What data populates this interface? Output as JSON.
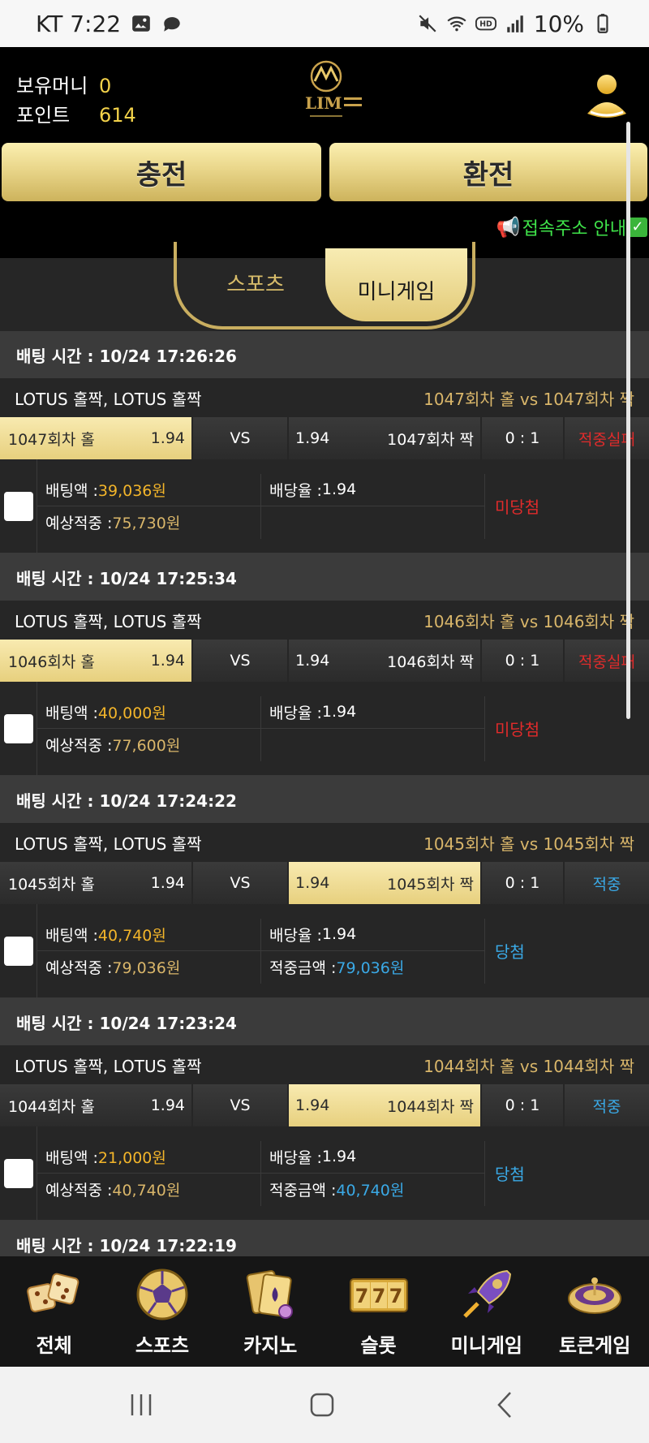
{
  "status_bar": {
    "carrier_time": "KT 7:22",
    "battery": "10%",
    "icons": [
      "image-icon",
      "chat-icon",
      "mute-icon",
      "wifi-icon",
      "hd-icon",
      "signal-icon",
      "battery-icon"
    ]
  },
  "header": {
    "balance_label": "보유머니",
    "balance_value": "0",
    "point_label": "포인트",
    "point_value": "614",
    "logo_text": "LIM",
    "charge_label": "충전",
    "exchange_label": "환전",
    "notice": "접속주소 안내"
  },
  "tabs": {
    "sports": "스포츠",
    "minigame": "미니게임"
  },
  "bets": [
    {
      "time": "배팅 시간 : 10/24 17:26:26",
      "game": "LOTUS 홀짝, LOTUS 홀짝",
      "match": "1047회차 홀  vs  1047회차 짝",
      "home": "1047회차 홀",
      "home_odds": "1.94",
      "vs": "VS",
      "away_odds": "1.94",
      "away": "1047회차 짝",
      "score": "0 : 1",
      "result": "적중실패",
      "selected": "home",
      "win": false,
      "bet_label": "배팅액 : ",
      "bet_amount": "39,036원",
      "odds_label": "배당율 : ",
      "odds": "1.94",
      "expected_label": "예상적중 : ",
      "expected": "75,730원",
      "payout_label": "",
      "payout": "",
      "status": "미당첨"
    },
    {
      "time": "배팅 시간 : 10/24 17:25:34",
      "game": "LOTUS 홀짝, LOTUS 홀짝",
      "match": "1046회차 홀  vs  1046회차 짝",
      "home": "1046회차 홀",
      "home_odds": "1.94",
      "vs": "VS",
      "away_odds": "1.94",
      "away": "1046회차 짝",
      "score": "0 : 1",
      "result": "적중실패",
      "selected": "home",
      "win": false,
      "bet_label": "배팅액 : ",
      "bet_amount": "40,000원",
      "odds_label": "배당율 : ",
      "odds": "1.94",
      "expected_label": "예상적중 : ",
      "expected": "77,600원",
      "payout_label": "",
      "payout": "",
      "status": "미당첨"
    },
    {
      "time": "배팅 시간 : 10/24 17:24:22",
      "game": "LOTUS 홀짝, LOTUS 홀짝",
      "match": "1045회차 홀  vs  1045회차 짝",
      "home": "1045회차 홀",
      "home_odds": "1.94",
      "vs": "VS",
      "away_odds": "1.94",
      "away": "1045회차 짝",
      "score": "0 : 1",
      "result": "적중",
      "selected": "away",
      "win": true,
      "bet_label": "배팅액 : ",
      "bet_amount": "40,740원",
      "odds_label": "배당율 : ",
      "odds": "1.94",
      "expected_label": "예상적중 : ",
      "expected": "79,036원",
      "payout_label": "적중금액 : ",
      "payout": "79,036원",
      "status": "당첨"
    },
    {
      "time": "배팅 시간 : 10/24 17:23:24",
      "game": "LOTUS 홀짝, LOTUS 홀짝",
      "match": "1044회차 홀  vs  1044회차 짝",
      "home": "1044회차 홀",
      "home_odds": "1.94",
      "vs": "VS",
      "away_odds": "1.94",
      "away": "1044회차 짝",
      "score": "0 : 1",
      "result": "적중",
      "selected": "away",
      "win": true,
      "bet_label": "배팅액 : ",
      "bet_amount": "21,000원",
      "odds_label": "배당율 : ",
      "odds": "1.94",
      "expected_label": "예상적중 : ",
      "expected": "40,740원",
      "payout_label": "적중금액 : ",
      "payout": "40,740원",
      "status": "당첨"
    },
    {
      "time": "배팅 시간 : 10/24 17:22:19"
    }
  ],
  "bottom_nav": [
    {
      "label": "전체",
      "icon": "dice-icon"
    },
    {
      "label": "스포츠",
      "icon": "soccer-ball-icon"
    },
    {
      "label": "카지노",
      "icon": "cards-icon"
    },
    {
      "label": "슬롯",
      "icon": "slot-777-icon"
    },
    {
      "label": "미니게임",
      "icon": "rocket-icon"
    },
    {
      "label": "토큰게임",
      "icon": "roulette-icon"
    }
  ],
  "colors": {
    "gold": "#e9d68a",
    "accent_yellow": "#f3d24a",
    "fail_red": "#e12b2b",
    "win_blue": "#3aa9e6",
    "notice_green": "#3fe34a"
  }
}
